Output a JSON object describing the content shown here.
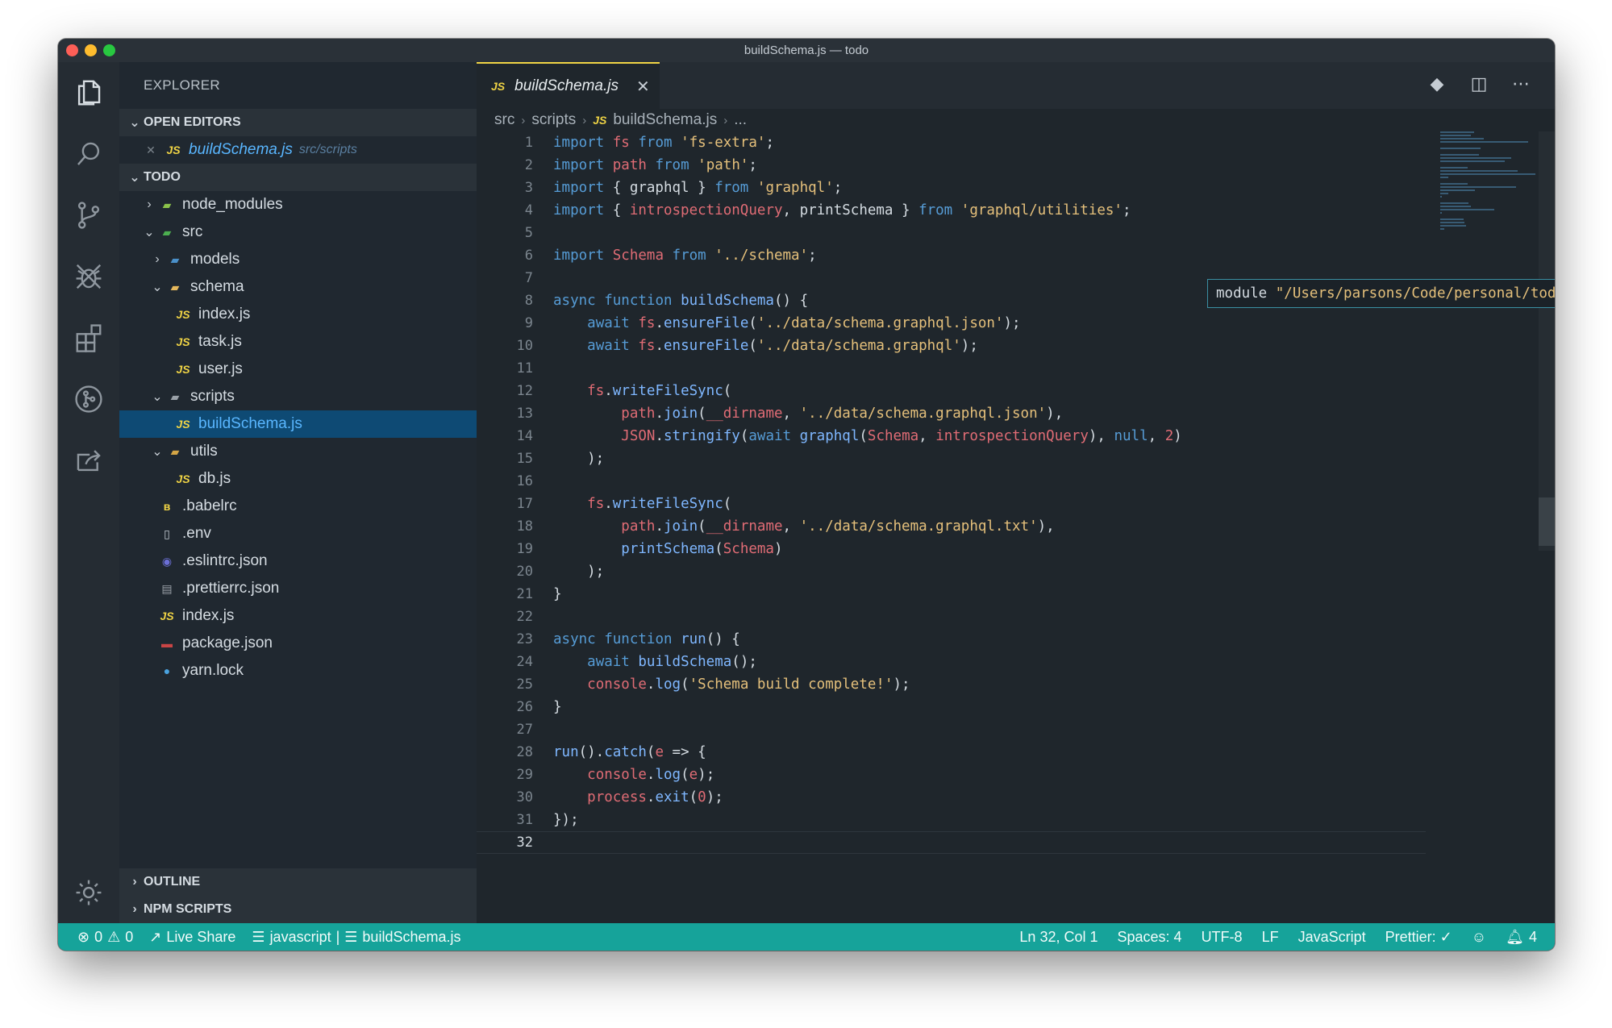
{
  "window": {
    "title": "buildSchema.js — todo"
  },
  "sidebar": {
    "title": "EXPLORER",
    "open_editors_label": "OPEN EDITORS",
    "open_editor": {
      "name": "buildSchema.js",
      "path": "src/scripts"
    },
    "project_label": "TODO",
    "tree": [
      {
        "name": "node_modules",
        "type": "folder",
        "depth": 1,
        "state": "collapsed"
      },
      {
        "name": "src",
        "type": "folder",
        "depth": 1,
        "state": "expanded"
      },
      {
        "name": "models",
        "type": "folder",
        "depth": 2,
        "state": "collapsed"
      },
      {
        "name": "schema",
        "type": "folder",
        "depth": 2,
        "state": "expanded"
      },
      {
        "name": "index.js",
        "type": "js",
        "depth": 3
      },
      {
        "name": "task.js",
        "type": "js",
        "depth": 3
      },
      {
        "name": "user.js",
        "type": "js",
        "depth": 3
      },
      {
        "name": "scripts",
        "type": "folder",
        "depth": 2,
        "state": "expanded"
      },
      {
        "name": "buildSchema.js",
        "type": "js",
        "depth": 3,
        "selected": true
      },
      {
        "name": "utils",
        "type": "folder",
        "depth": 2,
        "state": "expanded"
      },
      {
        "name": "db.js",
        "type": "js",
        "depth": 3
      },
      {
        "name": ".babelrc",
        "type": "babel",
        "depth": 1
      },
      {
        "name": ".env",
        "type": "file",
        "depth": 1
      },
      {
        "name": ".eslintrc.json",
        "type": "eslint",
        "depth": 1
      },
      {
        "name": ".prettierrc.json",
        "type": "prettier",
        "depth": 1
      },
      {
        "name": "index.js",
        "type": "js",
        "depth": 1
      },
      {
        "name": "package.json",
        "type": "npm",
        "depth": 1
      },
      {
        "name": "yarn.lock",
        "type": "yarn",
        "depth": 1
      }
    ],
    "outline_label": "OUTLINE",
    "npm_scripts_label": "NPM SCRIPTS"
  },
  "editor": {
    "tab": {
      "label": "buildSchema.js",
      "icon": "JS"
    },
    "breadcrumb": [
      "src",
      "scripts",
      "buildSchema.js",
      "..."
    ],
    "hover": {
      "keyword": "module",
      "path": "\"/Users/parsons/Code/personal/todo/src/schema/index\""
    },
    "current_line": 32,
    "lines": [
      "import fs from 'fs-extra';",
      "import path from 'path';",
      "import { graphql } from 'graphql';",
      "import { introspectionQuery, printSchema } from 'graphql/utilities';",
      "",
      "import Schema from '../schema';",
      "",
      "async function buildSchema() {",
      "    await fs.ensureFile('../data/schema.graphql.json');",
      "    await fs.ensureFile('../data/schema.graphql');",
      "",
      "    fs.writeFileSync(",
      "        path.join(__dirname, '../data/schema.graphql.json'),",
      "        JSON.stringify(await graphql(Schema, introspectionQuery), null, 2)",
      "    );",
      "",
      "    fs.writeFileSync(",
      "        path.join(__dirname, '../data/schema.graphql.txt'),",
      "        printSchema(Schema)",
      "    );",
      "}",
      "",
      "async function run() {",
      "    await buildSchema();",
      "    console.log('Schema build complete!');",
      "}",
      "",
      "run().catch(e => {",
      "    console.log(e);",
      "    process.exit(0);",
      "});",
      ""
    ]
  },
  "statusbar": {
    "errors": "0",
    "warnings": "0",
    "live_share": "Live Share",
    "language_symbol": "javascript",
    "symbol_file": "buildSchema.js",
    "position": "Ln 32, Col 1",
    "spaces": "Spaces: 4",
    "encoding": "UTF-8",
    "eol": "LF",
    "language": "JavaScript",
    "prettier": "Prettier: ✓",
    "notifications": "4"
  },
  "colors": {
    "statusbar": "#16a39a",
    "selection": "#0e4a74",
    "js_icon": "#f0d445",
    "keyword": "#569cd6",
    "string": "#e5c07b",
    "variable": "#e06c75"
  }
}
